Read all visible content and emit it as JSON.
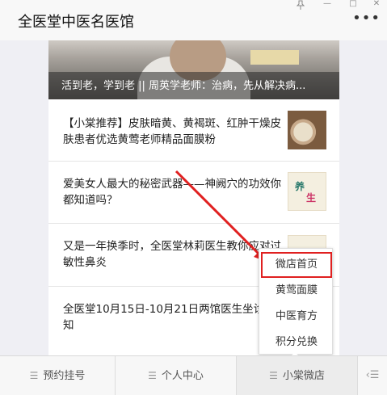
{
  "window": {
    "title": "全医堂中医名医馆",
    "pin_icon": "pin-icon",
    "minimize_glyph": "—",
    "maximize_glyph": "□",
    "close_glyph": "✕",
    "more_glyph": "•••"
  },
  "banner": {
    "caption": "活到老，学到老 || 周英学老师：治病，先从解决病..."
  },
  "articles": [
    {
      "title": "【小棠推荐】皮肤暗黄、黄褐斑、红肿干燥皮肤患者优选黄莺老师精品面膜粉",
      "thumb": "powder-bowl"
    },
    {
      "title": "爱美女人最大的秘密武器——神阙穴的功效你都知道吗？",
      "thumb": "health-tips",
      "thumb_text_a": "养",
      "thumb_text_b": "生"
    },
    {
      "title": "又是一年换季时，全医堂林莉医生教你应对过敏性鼻炎",
      "thumb": "health-tips"
    },
    {
      "title": "全医堂10月15日-10月21日两馆医生坐诊通知",
      "thumb": ""
    }
  ],
  "popup_menu": {
    "items": [
      "微店首页",
      "黄莺面膜",
      "中医育方",
      "积分兑换"
    ],
    "active_index": 0
  },
  "bottom_nav": {
    "tabs": [
      "预约挂号",
      "个人中心",
      "小棠微店"
    ],
    "tab_icon": "menu-icon",
    "keyboard_icon": "keyboard-icon",
    "keyboard_glyph": "‹☰"
  },
  "colors": {
    "highlight": "#e02020",
    "arrow": "#e02020"
  }
}
